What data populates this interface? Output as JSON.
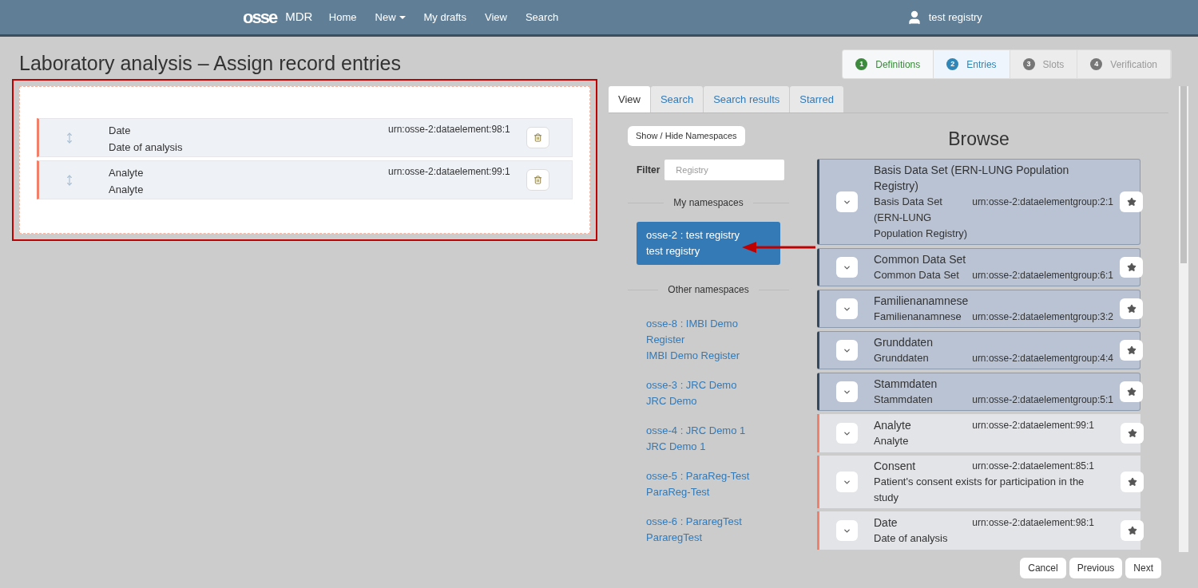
{
  "navbar": {
    "logo": "osse",
    "brand": "MDR",
    "links": [
      {
        "label": "Home",
        "dropdown": false
      },
      {
        "label": "New",
        "dropdown": true
      },
      {
        "label": "My drafts",
        "dropdown": false
      },
      {
        "label": "View",
        "dropdown": false
      },
      {
        "label": "Search",
        "dropdown": false
      }
    ],
    "user": "test registry"
  },
  "page_title": "Laboratory analysis – Assign record entries",
  "steps": [
    {
      "number": "1",
      "label": "Definitions",
      "completed": true,
      "selected": false
    },
    {
      "number": "2",
      "label": "Entries",
      "completed": false,
      "selected": true
    },
    {
      "number": "3",
      "label": "Slots",
      "completed": false,
      "selected": false
    },
    {
      "number": "4",
      "label": "Verification",
      "completed": false,
      "selected": false
    }
  ],
  "assigned_entries": [
    {
      "designation": "Date",
      "definition": "Date of analysis",
      "urn": "urn:osse-2:dataelement:98:1"
    },
    {
      "designation": "Analyte",
      "definition": "Analyte",
      "urn": "urn:osse-2:dataelement:99:1"
    }
  ],
  "tabs": [
    {
      "label": "View",
      "selected": true
    },
    {
      "label": "Search",
      "selected": false
    },
    {
      "label": "Search results",
      "selected": false
    },
    {
      "label": "Starred",
      "selected": false
    }
  ],
  "namespaces": {
    "toggle_button": "Show / Hide Namespaces",
    "filter_label": "Filter",
    "filter_placeholder": "Registry",
    "my_heading": "My namespaces",
    "mine": [
      {
        "name": "osse-2 : test registry",
        "title": "test registry",
        "selected": true
      }
    ],
    "other_heading": "Other namespaces",
    "others": [
      {
        "name": "osse-8 : IMBI Demo Register",
        "title": "IMBI Demo Register",
        "selected": false
      },
      {
        "name": "osse-3 : JRC Demo",
        "title": "JRC Demo",
        "selected": false
      },
      {
        "name": "osse-4 : JRC Demo 1",
        "title": "JRC Demo 1",
        "selected": false
      },
      {
        "name": "osse-5 : ParaReg-Test",
        "title": "ParaReg-Test",
        "selected": false
      },
      {
        "name": "osse-6 : PararegTest",
        "title": "PararegTest",
        "selected": false
      }
    ]
  },
  "browse": {
    "title": "Browse",
    "items": [
      {
        "kind": "group",
        "designation": "Basis Data Set (ERN-LUNG Population Registry)",
        "definition": "Basis Data Set (ERN-LUNG Population Registry)",
        "urn": "urn:osse-2:dataelementgroup:2:1"
      },
      {
        "kind": "group",
        "designation": "Common Data Set",
        "definition": "Common Data Set",
        "urn": "urn:osse-2:dataelementgroup:6:1"
      },
      {
        "kind": "group",
        "designation": "Familienanamnese",
        "definition": "Familienanamnese",
        "urn": "urn:osse-2:dataelementgroup:3:2"
      },
      {
        "kind": "group",
        "designation": "Grunddaten",
        "definition": "Grunddaten",
        "urn": "urn:osse-2:dataelementgroup:4:4"
      },
      {
        "kind": "group",
        "designation": "Stammdaten",
        "definition": "Stammdaten",
        "urn": "urn:osse-2:dataelementgroup:5:1"
      },
      {
        "kind": "element",
        "designation": "Analyte",
        "definition": "Analyte",
        "urn": "urn:osse-2:dataelement:99:1"
      },
      {
        "kind": "element",
        "designation": "Consent",
        "definition": "Patient's consent exists for participation in the study",
        "urn": "urn:osse-2:dataelement:85:1"
      },
      {
        "kind": "element",
        "designation": "Date",
        "definition": "Date of analysis",
        "urn": "urn:osse-2:dataelement:98:1"
      }
    ]
  },
  "footer_buttons": [
    "Cancel",
    "Previous",
    "Next"
  ]
}
